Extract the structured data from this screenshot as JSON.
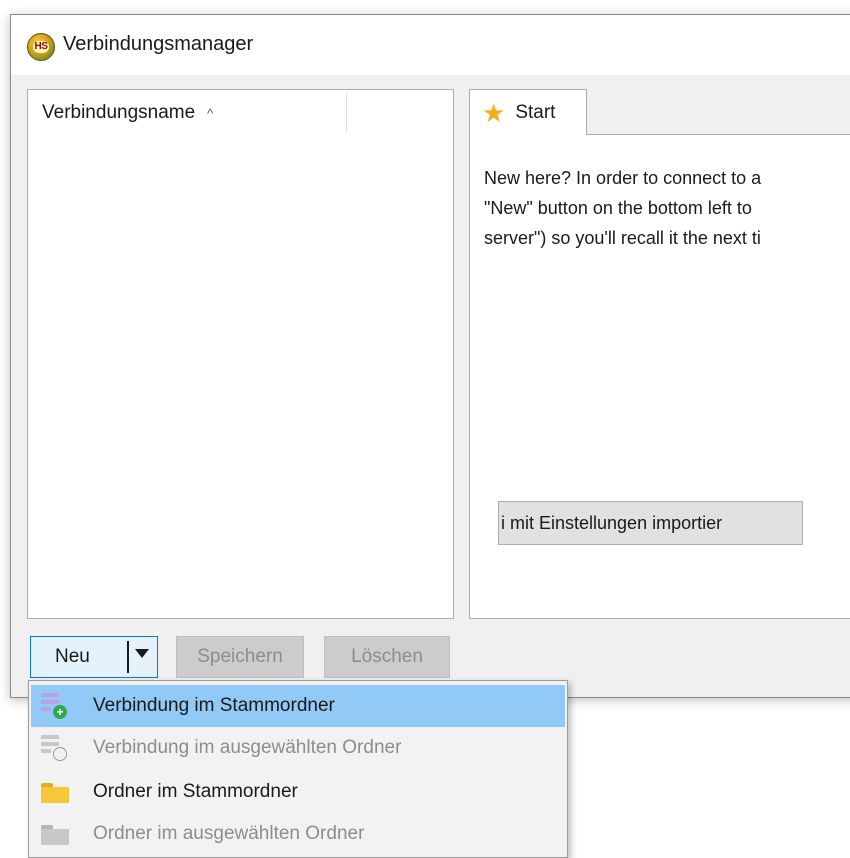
{
  "window": {
    "title": "Verbindungsmanager",
    "app_icon": "HS"
  },
  "connection_list": {
    "column_header": "Verbindungsname",
    "sort_indicator": "^",
    "items": []
  },
  "tabs": [
    {
      "label": "Start",
      "icon": "star-icon"
    }
  ],
  "start_tab": {
    "intro_lines": [
      "New here? In order to connect to a",
      "\"New\" button on the bottom left to",
      "server\") so you'll recall it the next ti"
    ],
    "import_button": "i mit Einstellungen importier"
  },
  "buttons": {
    "new": "Neu",
    "save": "Speichern",
    "delete": "Löschen"
  },
  "new_menu": {
    "items": [
      {
        "label": "Verbindung im Stammordner",
        "icon": "new-connection-icon",
        "enabled": true,
        "highlighted": true
      },
      {
        "label": "Verbindung im ausgewählten Ordner",
        "icon": "new-connection-icon",
        "enabled": false,
        "highlighted": false
      },
      {
        "label": "Ordner im Stammordner",
        "icon": "folder-icon",
        "enabled": true,
        "highlighted": false
      },
      {
        "label": "Ordner im ausgewählten Ordner",
        "icon": "folder-icon",
        "enabled": false,
        "highlighted": false
      }
    ]
  },
  "colors": {
    "accent": "#0078d7",
    "menu_highlight": "#91c9f7",
    "folder": "#f8c63a",
    "star": "#f2b01e",
    "add_green": "#2fa84f"
  }
}
